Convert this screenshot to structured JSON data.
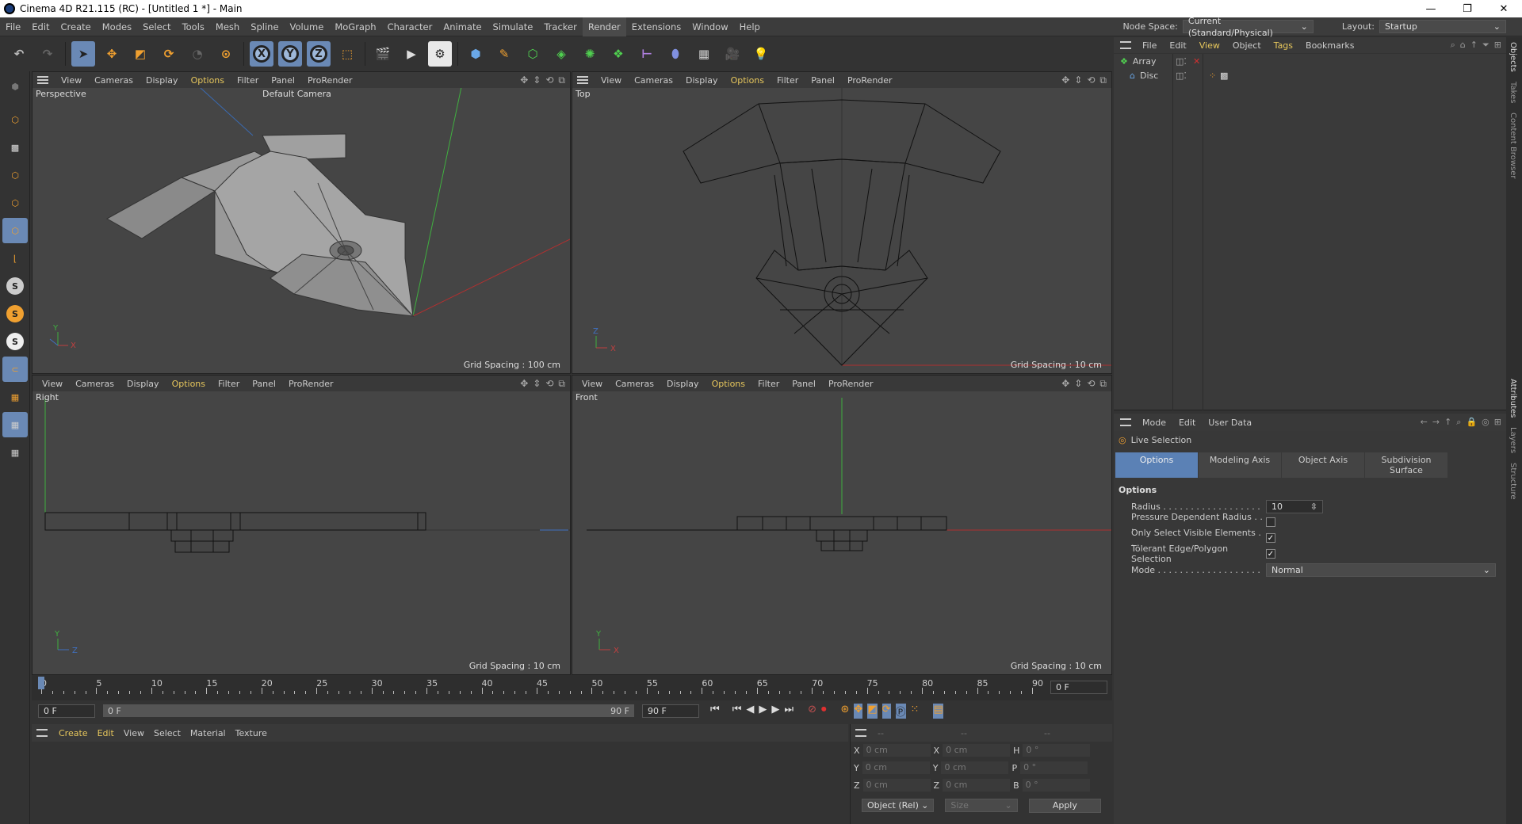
{
  "window": {
    "title": "Cinema 4D R21.115 (RC) - [Untitled 1 *] - Main"
  },
  "menu": [
    "File",
    "Edit",
    "Create",
    "Modes",
    "Select",
    "Tools",
    "Mesh",
    "Spline",
    "Volume",
    "MoGraph",
    "Character",
    "Animate",
    "Simulate",
    "Tracker",
    "Render",
    "Extensions",
    "Window",
    "Help"
  ],
  "node_space": {
    "label": "Node Space:",
    "value": "Current (Standard/Physical)"
  },
  "layout": {
    "label": "Layout:",
    "value": "Startup"
  },
  "viewport_menu": [
    "View",
    "Cameras",
    "Display",
    "Options",
    "Filter",
    "Panel",
    "ProRender"
  ],
  "viewports": {
    "persp": {
      "name": "Perspective",
      "camera": "Default Camera",
      "grid": "Grid Spacing : 100 cm"
    },
    "top": {
      "name": "Top",
      "grid": "Grid Spacing : 10 cm"
    },
    "right": {
      "name": "Right",
      "grid": "Grid Spacing : 10 cm"
    },
    "front": {
      "name": "Front",
      "grid": "Grid Spacing : 10 cm"
    }
  },
  "objects_menu": [
    "File",
    "Edit",
    "View",
    "Object",
    "Tags",
    "Bookmarks"
  ],
  "objects": [
    {
      "name": "Array"
    },
    {
      "name": "Disc"
    }
  ],
  "attributes": {
    "menu": [
      "Mode",
      "Edit",
      "User Data"
    ],
    "tool": "Live Selection",
    "tabs": [
      "Options",
      "Modeling Axis",
      "Object Axis",
      "Subdivision Surface"
    ],
    "section": "Options",
    "radius_label": "Radius . . . . . . . . . . . . . . . . . .",
    "radius": "10",
    "pressure_label": "Pressure Dependent Radius . . .",
    "visible_label": "Only Select Visible Elements . . .",
    "tolerant_label": "Tolerant Edge/Polygon Selection",
    "mode_label": "Mode . . . . . . . . . . . . . . . . . . .",
    "mode": "Normal"
  },
  "side_tabs": [
    "Objects",
    "Takes",
    "Content Browser"
  ],
  "side_tabs2": [
    "Attributes",
    "Layers",
    "Structure"
  ],
  "timeline": {
    "ticks": [
      "0",
      "5",
      "10",
      "15",
      "20",
      "25",
      "30",
      "35",
      "40",
      "45",
      "50",
      "55",
      "60",
      "65",
      "70",
      "75",
      "80",
      "85",
      "90"
    ],
    "current": "0 F"
  },
  "transport": {
    "start": "0 F",
    "range_start": "0 F",
    "range_end": "90 F",
    "end": "90 F"
  },
  "material_menu": [
    "Create",
    "Edit",
    "View",
    "Select",
    "Material",
    "Texture"
  ],
  "coords": {
    "header": [
      "--",
      "--",
      "--"
    ],
    "rows": [
      [
        "X",
        "0 cm",
        "X",
        "0 cm",
        "H",
        "0 °"
      ],
      [
        "Y",
        "0 cm",
        "Y",
        "0 cm",
        "P",
        "0 °"
      ],
      [
        "Z",
        "0 cm",
        "Z",
        "0 cm",
        "B",
        "0 °"
      ]
    ],
    "mode": "Object (Rel)",
    "size": "Size",
    "apply": "Apply"
  },
  "colors": {
    "accent": "#5b81b5",
    "options": "#e6c65c",
    "axis_x": "#c04040",
    "axis_y": "#40b040",
    "axis_z": "#4070c0"
  }
}
